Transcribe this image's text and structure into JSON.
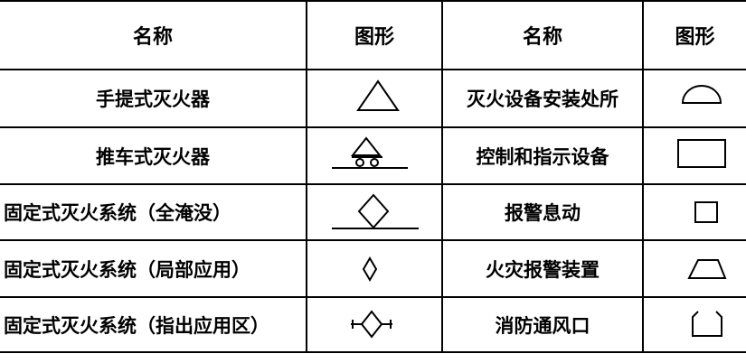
{
  "header": {
    "name_col_1": "名称",
    "shape_col_1": "图形",
    "name_col_2": "名称",
    "shape_col_2": "图形"
  },
  "rows": [
    {
      "left_name": "手提式灭火器",
      "left_icon": "triangle-icon",
      "right_name": "灭火设备安装处所",
      "right_icon": "semicircle-icon"
    },
    {
      "left_name": "推车式灭火器",
      "left_icon": "wheeled-triangle-icon",
      "right_name": "控制和指示设备",
      "right_icon": "rectangle-icon"
    },
    {
      "left_name": "固定式灭火系统（全淹没）",
      "left_icon": "diamond-on-line-icon",
      "right_name": "报警息动",
      "right_icon": "small-square-icon"
    },
    {
      "left_name": "固定式灭火系统（局部应用）",
      "left_icon": "small-diamond-icon",
      "right_name": "火灾报警装置",
      "right_icon": "trapezoid-icon"
    },
    {
      "left_name": "固定式灭火系统（指出应用区）",
      "left_icon": "diamond-with-arrows-icon",
      "right_name": "消防通风口",
      "right_icon": "open-box-icon"
    }
  ]
}
